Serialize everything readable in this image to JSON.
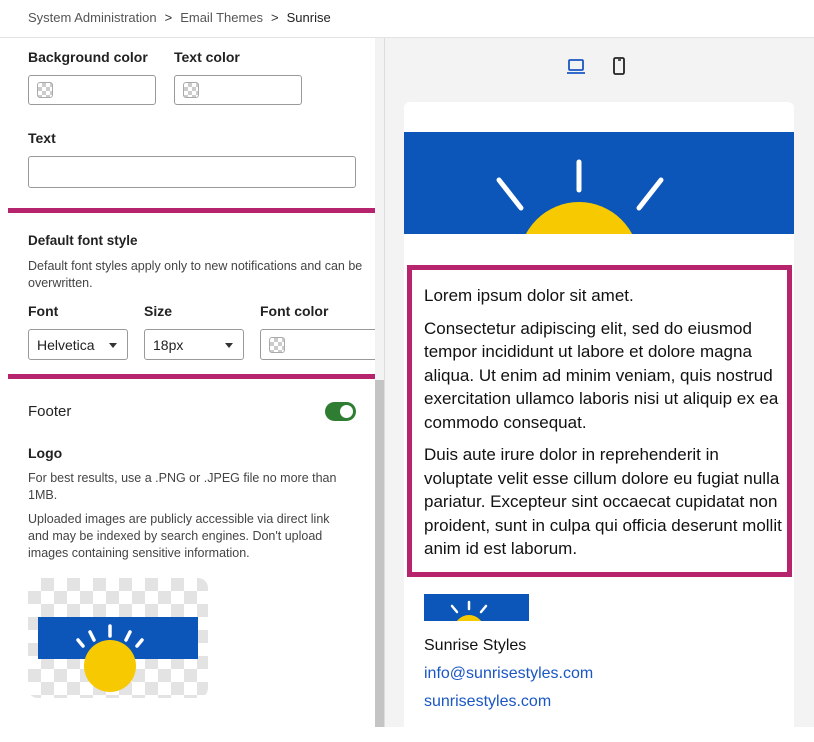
{
  "breadcrumb": {
    "items": [
      "System Administration",
      "Email Themes",
      "Sunrise"
    ],
    "separator": ">"
  },
  "settings": {
    "background_color_label": "Background color",
    "text_color_label": "Text color",
    "text_label": "Text",
    "text_value": "",
    "default_font_style": {
      "title": "Default font style",
      "description": "Default font styles apply only to new notifications and can be overwritten.",
      "font_label": "Font",
      "font_value": "Helvetica",
      "size_label": "Size",
      "size_value": "18px",
      "font_color_label": "Font color"
    },
    "footer": {
      "title": "Footer",
      "enabled": true,
      "logo_label": "Logo",
      "logo_hint": "For best results, use a .PNG or .JPEG file no more than 1MB.",
      "logo_notice": "Uploaded images are publicly accessible via direct link and may be indexed by search engines. Don't upload images containing sensitive information."
    }
  },
  "preview": {
    "devices": [
      "laptop-icon",
      "mobile-icon"
    ],
    "selected_device": "laptop",
    "body_paragraphs": [
      "Lorem ipsum dolor sit amet.",
      "Consectetur adipiscing elit, sed do eiusmod tempor incididunt ut labore et dolore magna aliqua. Ut enim ad minim veniam, quis nostrud exercitation ullamco laboris nisi ut aliquip ex ea commodo consequat.",
      "Duis aute irure dolor in reprehenderit in voluptate velit esse cillum dolore eu fugiat nulla pariatur. Excepteur sint occaecat cupidatat non proident, sunt in culpa qui officia deserunt mollit anim id est laborum."
    ],
    "footer_name": "Sunrise Styles",
    "footer_email": "info@sunrisestyles.com",
    "footer_site": "sunrisestyles.com"
  },
  "colors": {
    "highlight": "#b5246c",
    "banner_blue": "#0b56b8",
    "sun_yellow": "#f7c900",
    "toggle_on": "#2e7d32",
    "link": "#1a56c4"
  }
}
